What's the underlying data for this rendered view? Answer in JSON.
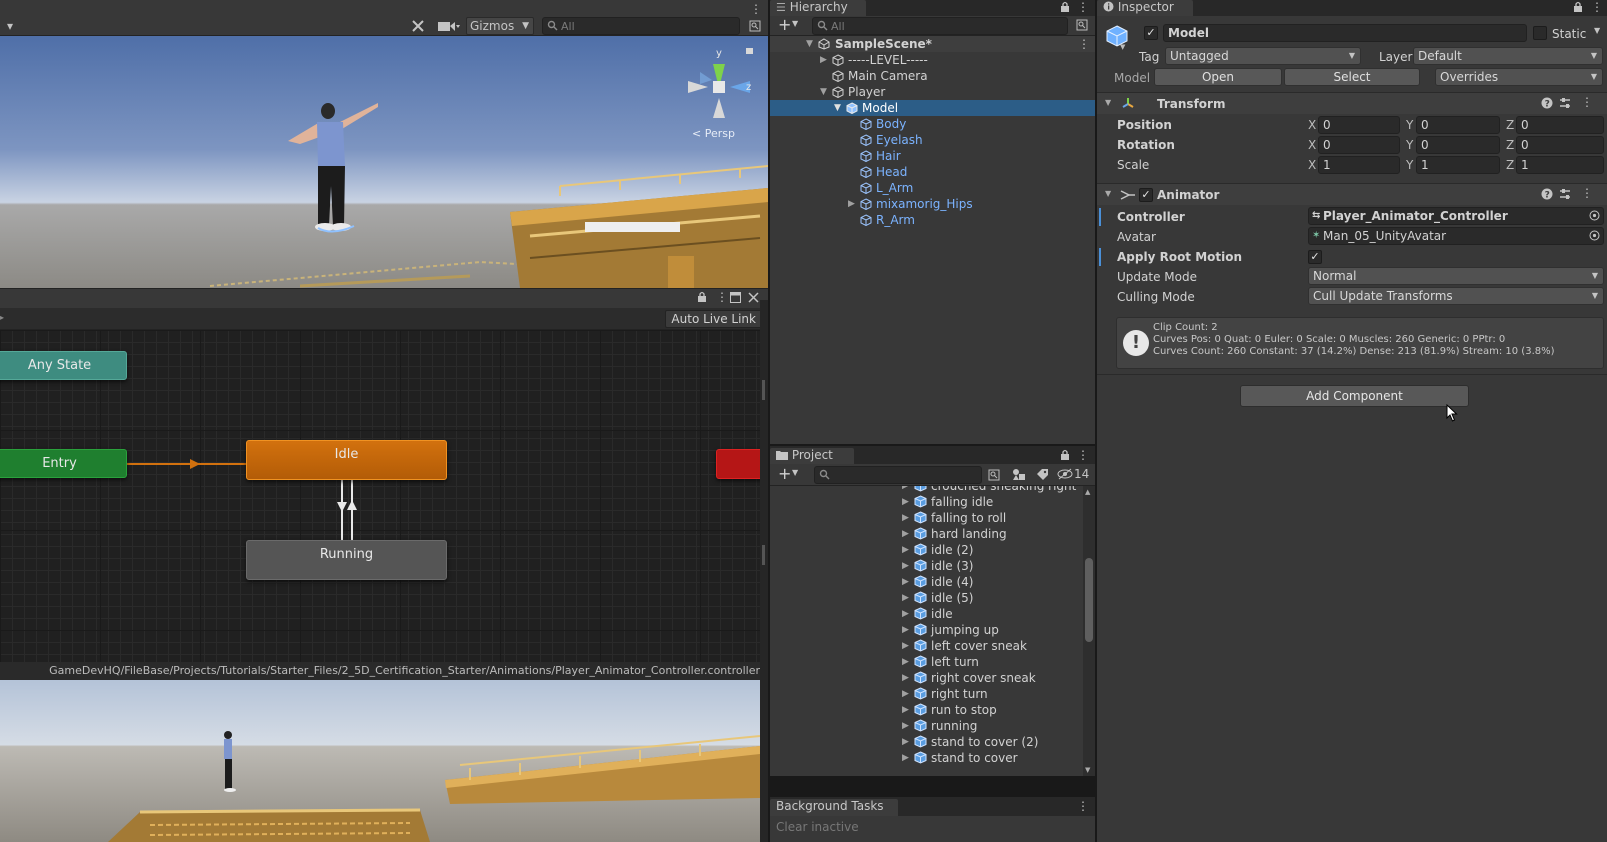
{
  "scene": {
    "gizmos_label": "Gizmos",
    "search_placeholder": "All",
    "persp_label": "< Persp",
    "axis_y": "y",
    "axis_z": "z"
  },
  "animator": {
    "auto_live_link": "Auto Live Link",
    "nodes": {
      "any_state": "Any State",
      "entry": "Entry",
      "idle": "Idle",
      "running": "Running"
    },
    "controller_path": "GameDevHQ/FileBase/Projects/Tutorials/Starter_Files/2_5D_Certification_Starter/Animations/Player_Animator_Controller.controller"
  },
  "hierarchy": {
    "tab_title": "Hierarchy",
    "search_placeholder": "All",
    "scene_name": "SampleScene*",
    "items": [
      {
        "label": "-----LEVEL-----"
      },
      {
        "label": "Main Camera"
      },
      {
        "label": "Player"
      },
      {
        "label": "Model"
      },
      {
        "label": "Body"
      },
      {
        "label": "Eyelash"
      },
      {
        "label": "Hair"
      },
      {
        "label": "Head"
      },
      {
        "label": "L_Arm"
      },
      {
        "label": "mixamorig_Hips"
      },
      {
        "label": "R_Arm"
      }
    ]
  },
  "project": {
    "tab_title": "Project",
    "hidden_count": "14",
    "items": [
      {
        "label": "crouched sneaking right"
      },
      {
        "label": "falling idle"
      },
      {
        "label": "falling to roll"
      },
      {
        "label": "hard landing"
      },
      {
        "label": "idle (2)"
      },
      {
        "label": "idle (3)"
      },
      {
        "label": "idle (4)"
      },
      {
        "label": "idle (5)"
      },
      {
        "label": "idle"
      },
      {
        "label": "jumping up"
      },
      {
        "label": "left cover sneak"
      },
      {
        "label": "left turn"
      },
      {
        "label": "right cover sneak"
      },
      {
        "label": "right turn"
      },
      {
        "label": "run to stop"
      },
      {
        "label": "running"
      },
      {
        "label": "stand to cover (2)"
      },
      {
        "label": "stand to cover"
      }
    ]
  },
  "background_tasks": {
    "tab_title": "Background Tasks",
    "clear_inactive": "Clear inactive"
  },
  "inspector": {
    "tab_title": "Inspector",
    "object_name": "Model",
    "static_label": "Static",
    "tag_label": "Tag",
    "tag_value": "Untagged",
    "layer_label": "Layer",
    "layer_value": "Default",
    "model_label": "Model",
    "open_button": "Open",
    "select_button": "Select",
    "overrides_label": "Overrides",
    "transform": {
      "title": "Transform",
      "position_label": "Position",
      "rotation_label": "Rotation",
      "scale_label": "Scale",
      "axis_x": "X",
      "axis_y": "Y",
      "axis_z": "Z",
      "position": {
        "x": "0",
        "y": "0",
        "z": "0"
      },
      "rotation": {
        "x": "0",
        "y": "0",
        "z": "0"
      },
      "scale": {
        "x": "1",
        "y": "1",
        "z": "1"
      }
    },
    "animator": {
      "title": "Animator",
      "controller_label": "Controller",
      "controller_value": "Player_Animator_Controller",
      "avatar_label": "Avatar",
      "avatar_value": "Man_05_UnityAvatar",
      "apply_root_motion_label": "Apply Root Motion",
      "update_mode_label": "Update Mode",
      "update_mode_value": "Normal",
      "culling_mode_label": "Culling Mode",
      "culling_mode_value": "Cull Update Transforms",
      "info_line1": "Clip Count: 2",
      "info_line2": "Curves Pos: 0 Quat: 0 Euler: 0 Scale: 0 Muscles: 260 Generic: 0 PPtr: 0",
      "info_line3": "Curves Count: 260 Constant: 37 (14.2%) Dense: 213 (81.9%) Stream: 10 (3.8%)"
    },
    "add_component": "Add Component"
  },
  "colors": {
    "idle_state": "#d2710e",
    "entry_state": "#1f7f2f",
    "any_state": "#3e8c80",
    "exit_state": "#b51616",
    "selection": "#2c5d87",
    "child_text": "#7bb3ff"
  },
  "icons": [
    "menu-dots-icon",
    "tools-icon",
    "camera-icon",
    "search-icon",
    "lock-icon",
    "maximize-icon",
    "close-icon",
    "plus-icon",
    "scene-icon",
    "cube-icon",
    "folder-icon",
    "clip-icon",
    "transform-icon",
    "animator-icon",
    "help-icon",
    "settings-icon",
    "info-icon",
    "cursor-icon"
  ]
}
